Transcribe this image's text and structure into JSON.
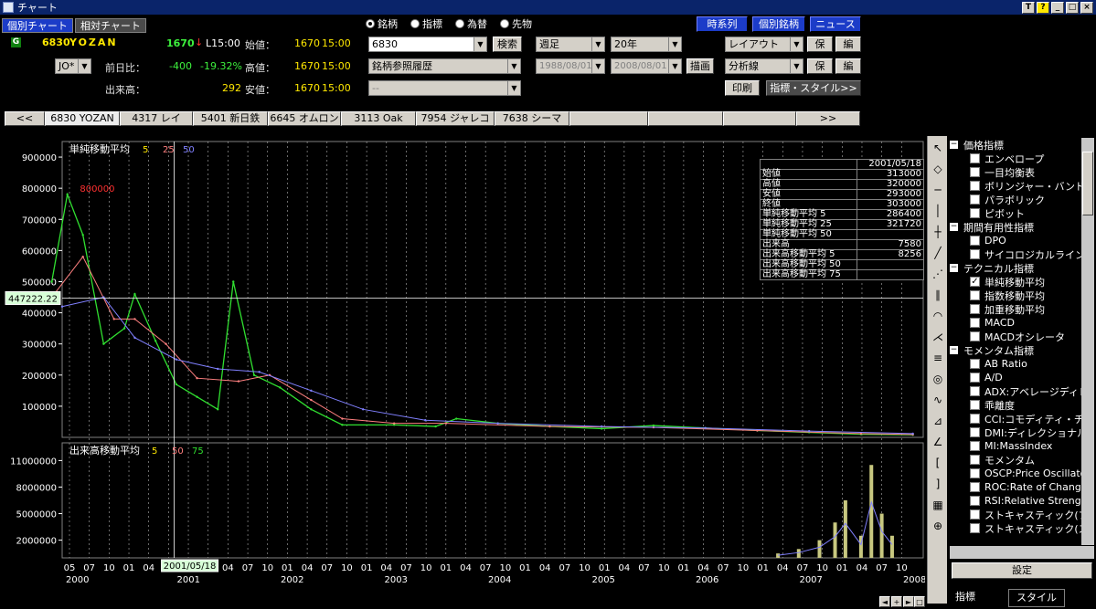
{
  "window": {
    "title": "チャート",
    "controls": [
      "T",
      "?",
      "_",
      "□",
      "×"
    ]
  },
  "chart_tabs": [
    "個別チャート",
    "相対チャート"
  ],
  "quote": {
    "code": "6830",
    "name": "YOZAN",
    "price": "1670",
    "arrow": "↓",
    "time": "L15:00",
    "open_label": "始値：",
    "open": "1670",
    "open_time": "15:00",
    "high_label": "高値：",
    "high": "1670",
    "high_time": "15:00",
    "low_label": "安値：",
    "low": "1670",
    "low_time": "15:00",
    "change_label": "前日比：",
    "change": "-400",
    "change_pct": "-19.32%",
    "volume_label": "出来高：",
    "volume": "292",
    "market": "JO*"
  },
  "mode_radios": [
    {
      "label": "銘柄",
      "selected": true
    },
    {
      "label": "指標",
      "selected": false
    },
    {
      "label": "為替",
      "selected": false
    },
    {
      "label": "先物",
      "selected": false
    }
  ],
  "search": {
    "code_value": "6830",
    "search_button": "検索",
    "history_value": "銘柄参照履歴",
    "third_value": "--"
  },
  "period": {
    "interval": "週足",
    "span": "20年",
    "from": "1988/08/01",
    "to": "2008/08/01",
    "draw_button": "描画"
  },
  "top_buttons": {
    "timeseries": "時系列",
    "individual": "個別銘柄",
    "news": "ニュース"
  },
  "layout": {
    "layout_combo": "レイアウト",
    "save1": "保存",
    "edit1": "編集",
    "analysis_combo": "分析線",
    "save2": "保存",
    "edit2": "編集",
    "print": "印刷",
    "indicator_style": "指標・スタイル>>"
  },
  "stock_tabs": [
    "<<",
    "6830 YOZAN",
    "4317 レイ",
    "5401 新日鉄",
    "6645 オムロン",
    "3113 Oak",
    "7954 ジャレコHD",
    "7638 シーマ",
    "",
    "",
    "",
    ">>"
  ],
  "colors": {
    "ma5": "#ffe800",
    "ma25": "#ff8080",
    "ma50": "#8080ff",
    "price_line": "#30e030",
    "accent_blue": "#1c3cc8"
  },
  "chart_data": [
    {
      "type": "line",
      "title": "単純移動平均",
      "legend": [
        "5",
        "25",
        "50"
      ],
      "yticks": [
        "900000",
        "800000",
        "700000",
        "600000",
        "500000",
        "400000",
        "300000",
        "200000",
        "100000"
      ],
      "ylim": [
        0,
        950000
      ],
      "cursor_value": "447222.22",
      "peak_label": "800000",
      "series": [
        {
          "name": "5",
          "x": [
            2000.2,
            2000.35,
            2000.5,
            2000.7,
            2000.9,
            2001.0,
            2001.2,
            2001.4,
            2001.6,
            2001.8,
            2001.95,
            2002.15,
            2002.4,
            2002.7,
            2003.0,
            2003.5,
            2003.9,
            2004.1,
            2004.5,
            2005.0,
            2005.5,
            2006.0,
            2006.5,
            2007.0,
            2007.5,
            2008.0,
            2008.5
          ],
          "values": [
            500000,
            780000,
            650000,
            300000,
            350000,
            460000,
            310000,
            170000,
            130000,
            90000,
            500000,
            200000,
            160000,
            90000,
            40000,
            40000,
            35000,
            60000,
            45000,
            35000,
            28000,
            38000,
            30000,
            22000,
            16000,
            10000,
            8000
          ]
        },
        {
          "name": "25",
          "x": [
            2000.2,
            2000.5,
            2000.8,
            2001.0,
            2001.3,
            2001.6,
            2002.0,
            2002.3,
            2002.7,
            2003.0,
            2003.5,
            2004.0,
            2005.0,
            2006.0,
            2007.0,
            2008.0,
            2008.5
          ],
          "values": [
            450000,
            580000,
            380000,
            380000,
            300000,
            190000,
            180000,
            200000,
            120000,
            60000,
            45000,
            45000,
            35000,
            32000,
            22000,
            12000,
            9000
          ]
        },
        {
          "name": "50",
          "x": [
            2000.3,
            2000.7,
            2001.0,
            2001.4,
            2001.8,
            2002.2,
            2002.7,
            2003.2,
            2003.8,
            2004.5,
            2005.5,
            2006.5,
            2007.5,
            2008.5
          ],
          "values": [
            420000,
            450000,
            320000,
            250000,
            220000,
            210000,
            150000,
            90000,
            55000,
            45000,
            35000,
            30000,
            20000,
            12000
          ]
        }
      ]
    },
    {
      "type": "bar",
      "title": "出来高移動平均",
      "legend": [
        "5",
        "50",
        "75"
      ],
      "yticks": [
        "11000000",
        "8000000",
        "5000000",
        "2000000"
      ],
      "ylim": [
        0,
        13000000
      ],
      "x": [
        2007.2,
        2007.4,
        2007.6,
        2007.75,
        2007.85,
        2008.0,
        2008.1,
        2008.2,
        2008.3
      ],
      "values": [
        500000,
        1000000,
        2000000,
        4000000,
        6500000,
        2500000,
        10500000,
        5000000,
        2500000
      ]
    }
  ],
  "x_axis": {
    "months": [
      "05",
      "07",
      "10",
      "01",
      "04",
      "07",
      "10",
      "01",
      "04",
      "07",
      "10",
      "01",
      "04",
      "07",
      "10",
      "01",
      "04",
      "07",
      "10",
      "01",
      "04",
      "07",
      "10",
      "01",
      "04",
      "07",
      "10",
      "01",
      "04",
      "07",
      "10",
      "01",
      "04",
      "07",
      "10",
      "01",
      "04",
      "07",
      "10",
      "01",
      "04",
      "07",
      "10"
    ],
    "years": [
      "2000",
      "2001",
      "2002",
      "2003",
      "2004",
      "2005",
      "2006",
      "2007",
      "2008"
    ],
    "cursor_date": "2001/05/18"
  },
  "data_table": {
    "date": "2001/05/18",
    "rows": [
      {
        "label": "始値",
        "value": "313000"
      },
      {
        "label": "高値",
        "value": "320000"
      },
      {
        "label": "安値",
        "value": "293000"
      },
      {
        "label": "終値",
        "value": "303000"
      },
      {
        "label": "単純移動平均 5",
        "value": "286400"
      },
      {
        "label": "単純移動平均 25",
        "value": "321720"
      },
      {
        "label": "単純移動平均 50",
        "value": ""
      },
      {
        "label": "出来高",
        "value": "7580"
      },
      {
        "label": "出来高移動平均 5",
        "value": "8256"
      },
      {
        "label": "出来高移動平均 50",
        "value": ""
      },
      {
        "label": "出来高移動平均 75",
        "value": ""
      }
    ]
  },
  "indicator_tree": [
    {
      "group": "価格指標",
      "items": [
        {
          "label": "エンベロープ",
          "checked": false
        },
        {
          "label": "一目均衡表",
          "checked": false
        },
        {
          "label": "ボリンジャー・バンド",
          "checked": false
        },
        {
          "label": "パラボリック",
          "checked": false
        },
        {
          "label": "ピボット",
          "checked": false
        }
      ]
    },
    {
      "group": "期間有用性指標",
      "items": [
        {
          "label": "DPO",
          "checked": false
        },
        {
          "label": "サイコロジカルライン",
          "checked": false
        }
      ]
    },
    {
      "group": "テクニカル指標",
      "items": [
        {
          "label": "単純移動平均",
          "checked": true
        },
        {
          "label": "指数移動平均",
          "checked": false
        },
        {
          "label": "加重移動平均",
          "checked": false
        },
        {
          "label": "MACD",
          "checked": false
        },
        {
          "label": "MACDオシレータ",
          "checked": false
        }
      ]
    },
    {
      "group": "モメンタム指標",
      "items": [
        {
          "label": "AB Ratio",
          "checked": false
        },
        {
          "label": "A/D",
          "checked": false
        },
        {
          "label": "ADX:アベレージディレ",
          "checked": false
        },
        {
          "label": "乖離度",
          "checked": false
        },
        {
          "label": "CCI:コモディティ・チャ",
          "checked": false
        },
        {
          "label": "DMI:ディレクショナル・",
          "checked": false
        },
        {
          "label": "MI:MassIndex",
          "checked": false
        },
        {
          "label": "モメンタム",
          "checked": false
        },
        {
          "label": "OSCP:Price Oscillator",
          "checked": false
        },
        {
          "label": "ROC:Rate of Change",
          "checked": false
        },
        {
          "label": "RSI:Relative Strength",
          "checked": false
        },
        {
          "label": "ストキャスティック(ファ",
          "checked": false
        },
        {
          "label": "ストキャスティック(スロ",
          "checked": false
        }
      ]
    }
  ],
  "indicator_panel": {
    "settings_button": "設定",
    "tab_indicator": "指標",
    "tab_style": "スタイル"
  },
  "tools": [
    "pointer-icon",
    "eraser-icon",
    "hline-icon",
    "vline-icon",
    "cross-icon",
    "trendline-icon",
    "fan-icon",
    "channel-icon",
    "fibo-arc-icon",
    "fibo-fan-icon",
    "fibo-retrace-icon",
    "cycle-icon",
    "wave-icon",
    "gann-icon",
    "angle-icon",
    "bracket-icon",
    "period-icon",
    "grid-icon",
    "target-icon"
  ]
}
